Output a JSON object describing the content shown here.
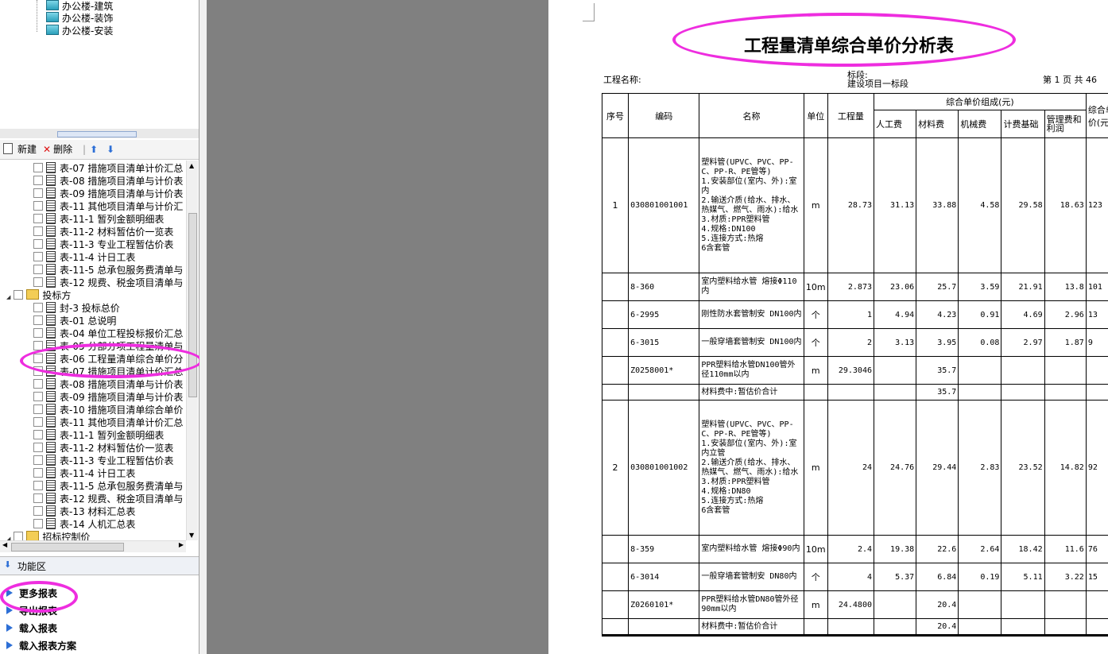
{
  "top_tree": [
    "办公楼-建筑",
    "办公楼-装饰",
    "办公楼-安装"
  ],
  "toolbar": {
    "new": "新建",
    "delete": "删除"
  },
  "report_list": [
    {
      "label": "表-07  措施项目清单计价汇总",
      "kind": "doc"
    },
    {
      "label": "表-08  措施项目清单与计价表",
      "kind": "doc"
    },
    {
      "label": "表-09  措施项目清单与计价表",
      "kind": "doc"
    },
    {
      "label": "表-11  其他项目清单与计价汇",
      "kind": "doc"
    },
    {
      "label": "表-11-1  暂列金额明细表",
      "kind": "doc"
    },
    {
      "label": "表-11-2  材料暂估价一览表",
      "kind": "doc"
    },
    {
      "label": "表-11-3  专业工程暂估价表",
      "kind": "doc"
    },
    {
      "label": "表-11-4  计日工表",
      "kind": "doc"
    },
    {
      "label": "表-11-5  总承包服务费清单与",
      "kind": "doc"
    },
    {
      "label": "表-12  规费、税金项目清单与",
      "kind": "doc"
    },
    {
      "label": "投标方",
      "kind": "folder"
    },
    {
      "label": "封-3  投标总价",
      "kind": "doc"
    },
    {
      "label": "表-01  总说明",
      "kind": "doc"
    },
    {
      "label": "表-04  单位工程投标报价汇总",
      "kind": "doc"
    },
    {
      "label": "表-05  分部分项工程量清单与",
      "kind": "doc"
    },
    {
      "label": "表-06  工程量清单综合单价分",
      "kind": "doc"
    },
    {
      "label": "表-07  措施项目清单计价汇总",
      "kind": "doc"
    },
    {
      "label": "表-08  措施项目清单与计价表",
      "kind": "doc"
    },
    {
      "label": "表-09  措施项目清单与计价表",
      "kind": "doc"
    },
    {
      "label": "表-10  措施项目清单综合单价",
      "kind": "doc"
    },
    {
      "label": "表-11  其他项目清单计价汇总",
      "kind": "doc"
    },
    {
      "label": "表-11-1  暂列金额明细表",
      "kind": "doc"
    },
    {
      "label": "表-11-2  材料暂估价一览表",
      "kind": "doc"
    },
    {
      "label": "表-11-3  专业工程暂估价表",
      "kind": "doc"
    },
    {
      "label": "表-11-4  计日工表",
      "kind": "doc"
    },
    {
      "label": "表-11-5  总承包服务费清单与",
      "kind": "doc"
    },
    {
      "label": "表-12  规费、税金项目清单与",
      "kind": "doc"
    },
    {
      "label": "表-13  材料汇总表",
      "kind": "doc"
    },
    {
      "label": "表-14  人机汇总表",
      "kind": "doc"
    },
    {
      "label": "招标控制价",
      "kind": "folder"
    }
  ],
  "func_area": {
    "label": "功能区"
  },
  "func_items": [
    "更多报表",
    "导出报表",
    "载入报表",
    "载入报表方案"
  ],
  "document": {
    "title": "工程量清单综合单价分析表",
    "project_label": "工程名称:",
    "section_label": "标段:",
    "section_value": "建设项目一标段",
    "page_info": "第 1 页   共 46",
    "headers": {
      "seq": "序号",
      "code": "编码",
      "name": "名称",
      "unit": "单位",
      "qty": "工程量",
      "group": "综合单价组成(元)",
      "labor": "人工费",
      "material": "材料费",
      "machine": "机械费",
      "fee_base": "计费基础",
      "mgmt": "管理费和利润",
      "total": "综合单价(元)"
    },
    "rows": [
      {
        "seq": "1",
        "code": "030801001001",
        "name": "塑料管(UPVC、PVC、PP-C、PP-R、PE管等)\n1.安装部位(室内、外):室内\n2.输送介质(给水、排水、热媒气、燃气、雨水):给水\n3.材质:PPR塑料管\n4.规格:DN100\n5.连接方式:热熔\n6含套管",
        "unit": "m",
        "qty": "28.73",
        "labor": "31.13",
        "material": "33.88",
        "machine": "4.58",
        "fee_base": "29.58",
        "mgmt": "18.63",
        "total": "123",
        "h": 170
      },
      {
        "seq": "",
        "code": "8-360",
        "name": "室内塑料给水管 熔接Φ110内",
        "unit": "10m",
        "qty": "2.873",
        "labor": "23.06",
        "material": "25.7",
        "machine": "3.59",
        "fee_base": "21.91",
        "mgmt": "13.8",
        "total": "101",
        "h": 35
      },
      {
        "seq": "",
        "code": "6-2995",
        "name": "刚性防水套管制安 DN100内",
        "unit": "个",
        "qty": "1",
        "labor": "4.94",
        "material": "4.23",
        "machine": "0.91",
        "fee_base": "4.69",
        "mgmt": "2.96",
        "total": "13",
        "h": 35
      },
      {
        "seq": "",
        "code": "6-3015",
        "name": "一般穿墙套管制安 DN100内",
        "unit": "个",
        "qty": "2",
        "labor": "3.13",
        "material": "3.95",
        "machine": "0.08",
        "fee_base": "2.97",
        "mgmt": "1.87",
        "total": "9",
        "h": 35
      },
      {
        "seq": "",
        "code": "Z0258001*",
        "name": "PPR塑料给水管DN100管外径110mm以内",
        "unit": "m",
        "qty": "29.3046",
        "labor": "",
        "material": "35.7",
        "machine": "",
        "fee_base": "",
        "mgmt": "",
        "total": "",
        "h": 35
      },
      {
        "seq": "",
        "code": "",
        "name": "材料费中:暂估价合计",
        "unit": "",
        "qty": "",
        "labor": "",
        "material": "35.7",
        "machine": "",
        "fee_base": "",
        "mgmt": "",
        "total": "",
        "h": 20
      },
      {
        "seq": "2",
        "code": "030801001002",
        "name": "塑料管(UPVC、PVC、PP-C、PP-R、PE管等)\n1.安装部位(室内、外):室内立管\n2.输送介质(给水、排水、热媒气、燃气、雨水):给水\n3.材质:PPR塑料管\n4.规格:DN80\n5.连接方式:热熔\n6含套管",
        "unit": "m",
        "qty": "24",
        "labor": "24.76",
        "material": "29.44",
        "machine": "2.83",
        "fee_base": "23.52",
        "mgmt": "14.82",
        "total": "92",
        "h": 170
      },
      {
        "seq": "",
        "code": "8-359",
        "name": "室内塑料给水管 熔接Φ90内",
        "unit": "10m",
        "qty": "2.4",
        "labor": "19.38",
        "material": "22.6",
        "machine": "2.64",
        "fee_base": "18.42",
        "mgmt": "11.6",
        "total": "76",
        "h": 35
      },
      {
        "seq": "",
        "code": "6-3014",
        "name": "一般穿墙套管制安 DN80内",
        "unit": "个",
        "qty": "4",
        "labor": "5.37",
        "material": "6.84",
        "machine": "0.19",
        "fee_base": "5.11",
        "mgmt": "3.22",
        "total": "15",
        "h": 35
      },
      {
        "seq": "",
        "code": "Z0260101*",
        "name": "PPR塑料给水管DN80管外径90mm以内",
        "unit": "m",
        "qty": "24.4800",
        "labor": "",
        "material": "20.4",
        "machine": "",
        "fee_base": "",
        "mgmt": "",
        "total": "",
        "h": 35
      },
      {
        "seq": "",
        "code": "",
        "name": "材料费中:暂估价合计",
        "unit": "",
        "qty": "",
        "labor": "",
        "material": "20.4",
        "machine": "",
        "fee_base": "",
        "mgmt": "",
        "total": "",
        "h": 20
      }
    ]
  },
  "colors": {
    "highlight": "#ee2ddf",
    "gray_area": "#808080"
  }
}
